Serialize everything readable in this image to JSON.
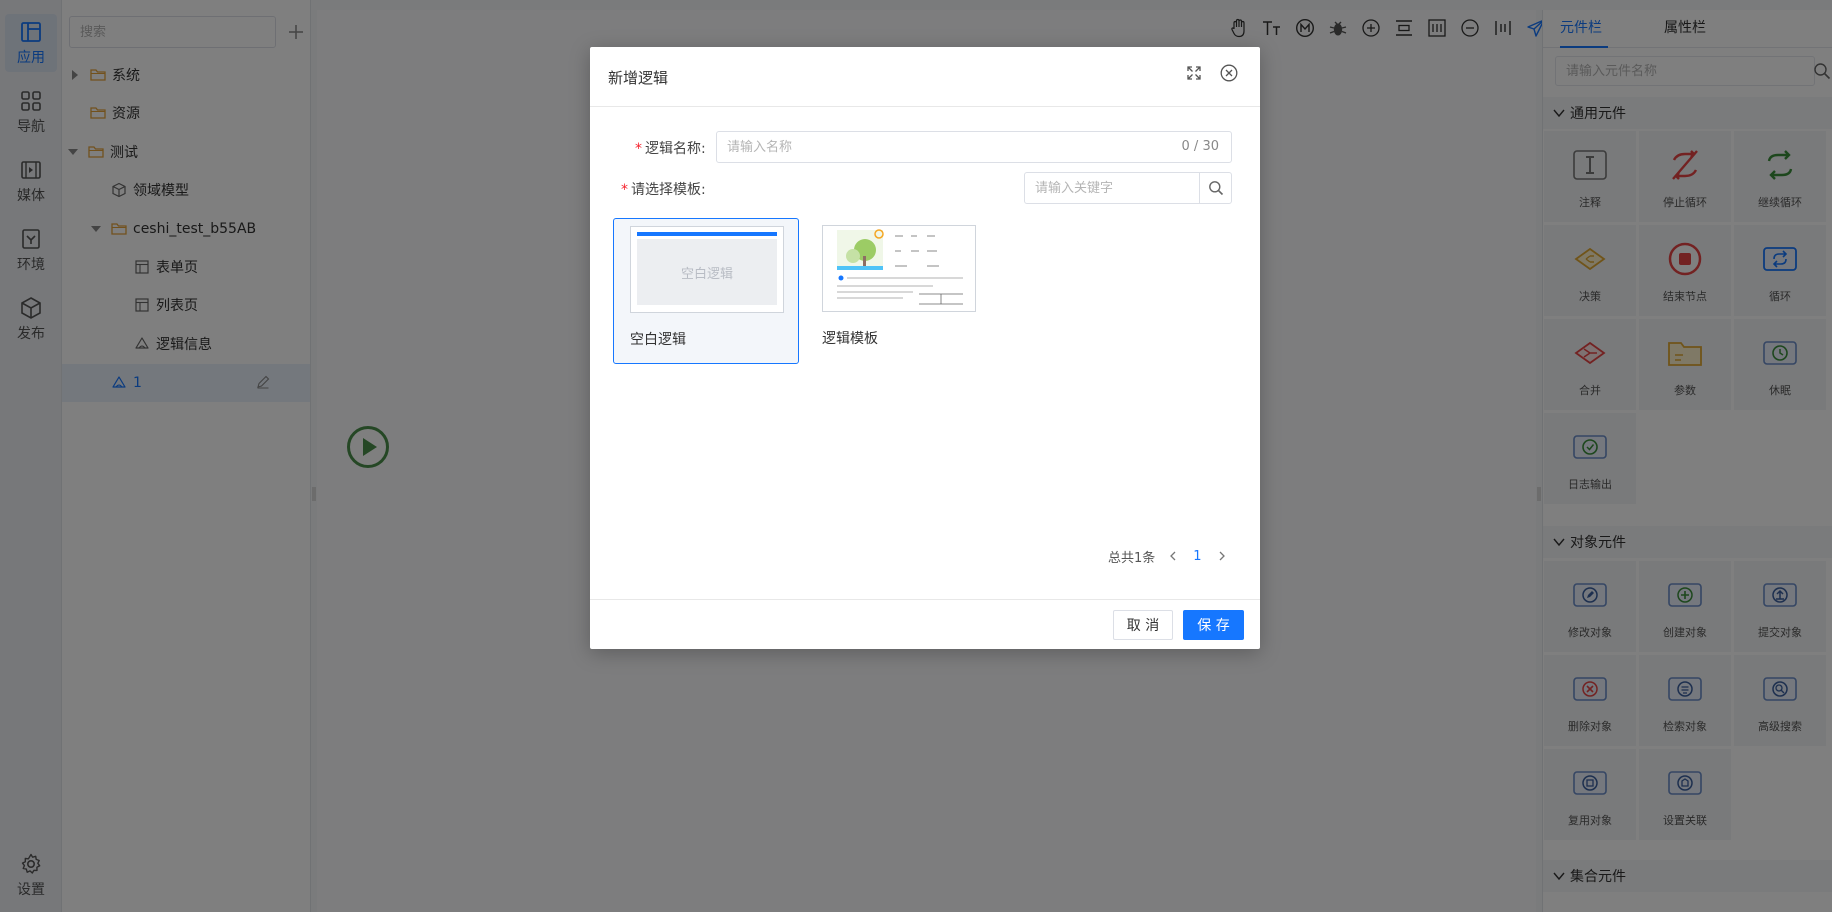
{
  "colors": {
    "accent": "#1677ff",
    "folder": "#e5a33a",
    "required": "#f5222d",
    "overlay": "rgba(0,0,0,0.5)"
  },
  "rail": {
    "items": [
      {
        "label": "应用",
        "icon": "app-layout-icon",
        "active": true
      },
      {
        "label": "导航",
        "icon": "grid-icon"
      },
      {
        "label": "媒体",
        "icon": "media-icon"
      },
      {
        "label": "环境",
        "icon": "environment-icon"
      },
      {
        "label": "发布",
        "icon": "package-icon"
      }
    ],
    "settings": {
      "label": "设置",
      "icon": "gear-icon"
    }
  },
  "tree": {
    "search_placeholder": "搜索",
    "add_icon": "plus-icon",
    "items": [
      {
        "label": "系统",
        "icon": "folder-icon",
        "expander": "collapsed"
      },
      {
        "label": "资源",
        "icon": "folder-icon"
      },
      {
        "label": "测试",
        "icon": "folder-icon",
        "expander": "expanded"
      },
      {
        "label": "领域模型",
        "icon": "cube-icon"
      },
      {
        "label": "ceshi_test_b55AB",
        "icon": "folder-icon",
        "expander": "expanded"
      },
      {
        "label": "表单页",
        "icon": "page-icon"
      },
      {
        "label": "列表页",
        "icon": "page-icon"
      },
      {
        "label": "逻辑信息",
        "icon": "logic-icon"
      },
      {
        "label": "1",
        "icon": "logic-icon",
        "selected": true,
        "edit_icon": "pencil-icon"
      }
    ]
  },
  "toolbar": {
    "buttons": [
      "hand-icon",
      "text-size-icon",
      "m-circle-icon",
      "bug-icon",
      "zoom-in-icon",
      "align-icon",
      "fit-icon",
      "zoom-out-icon",
      "distribute-icon",
      "send-icon"
    ]
  },
  "canvas": {
    "start_icon": "play-circle-icon"
  },
  "palette": {
    "tabs": [
      "元件栏",
      "属性栏"
    ],
    "active_tab": 0,
    "search_placeholder": "请输入元件名称",
    "sections": [
      {
        "title": "通用元件",
        "items": [
          {
            "label": "注释",
            "icon": "comment-icon"
          },
          {
            "label": "停止循环",
            "icon": "stop-loop-icon"
          },
          {
            "label": "继续循环",
            "icon": "continue-loop-icon"
          },
          {
            "label": "决策",
            "icon": "decision-icon"
          },
          {
            "label": "结束节点",
            "icon": "end-node-icon"
          },
          {
            "label": "循环",
            "icon": "loop-icon"
          },
          {
            "label": "合并",
            "icon": "merge-icon"
          },
          {
            "label": "参数",
            "icon": "parameter-icon"
          },
          {
            "label": "休眠",
            "icon": "sleep-icon"
          },
          {
            "label": "日志输出",
            "icon": "log-output-icon"
          }
        ]
      },
      {
        "title": "对象元件",
        "items": [
          {
            "label": "修改对象",
            "icon": "edit-object-icon"
          },
          {
            "label": "创建对象",
            "icon": "create-object-icon"
          },
          {
            "label": "提交对象",
            "icon": "submit-object-icon"
          },
          {
            "label": "删除对象",
            "icon": "delete-object-icon"
          },
          {
            "label": "检索对象",
            "icon": "retrieve-object-icon"
          },
          {
            "label": "高级搜索",
            "icon": "advanced-search-icon"
          },
          {
            "label": "复用对象",
            "icon": "reuse-object-icon"
          },
          {
            "label": "设置关联",
            "icon": "set-association-icon"
          }
        ]
      },
      {
        "title": "集合元件",
        "items": []
      }
    ]
  },
  "dialog": {
    "title": "新增逻辑",
    "maximize_icon": "maximize-icon",
    "close_icon": "close-circle-icon",
    "name_label": "逻辑名称:",
    "name_placeholder": "请输入名称",
    "name_value": "",
    "name_counter": "0 / 30",
    "template_label": "请选择模板:",
    "keyword_placeholder": "请输入关键字",
    "keyword_icon": "search-icon",
    "templates": [
      {
        "name": "空白逻辑",
        "thumb_text": "空白逻辑",
        "selected": true
      },
      {
        "name": "逻辑模板",
        "selected": false
      }
    ],
    "pagination": {
      "total": "总共1条",
      "current": "1"
    },
    "cancel": "取 消",
    "save": "保 存"
  }
}
